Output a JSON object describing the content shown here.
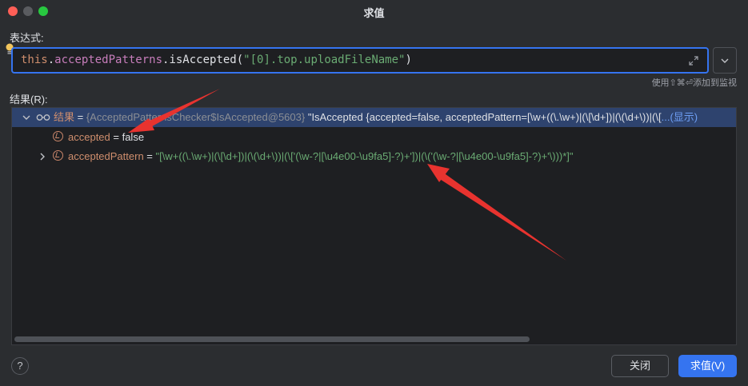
{
  "window": {
    "title": "求值"
  },
  "expression": {
    "label": "表达式:",
    "tokens": {
      "kw": "this",
      "dot1": ".",
      "field": "acceptedPatterns",
      "call": ".isAccepted(",
      "arg": "\"[0].top.uploadFileName\"",
      "close": ")"
    },
    "hint": "使用⇧⌘⏎添加到监视"
  },
  "result": {
    "label": "结果(R):",
    "root": {
      "name": "结果",
      "eq": " = ",
      "type": "{AcceptedPatternsChecker$IsAccepted@5603}",
      "value": " \"IsAccepted {accepted=false, acceptedPattern=[\\w+((\\.\\w+)|(\\[\\d+])|(\\(\\d+\\))|(\\[",
      "more": "...(显示)"
    },
    "children": [
      {
        "name": "accepted",
        "eq": " = ",
        "value": "false"
      },
      {
        "name": "acceptedPattern",
        "eq": " = ",
        "value": "\"[\\w+((\\.\\w+)|(\\[\\d+])|(\\(\\d+\\))|(\\['(\\w-?|[\\u4e00-\\u9fa5]-?)+'])|(\\('(\\w-?|[\\u4e00-\\u9fa5]-?)+'\\)))*]\""
      }
    ]
  },
  "buttons": {
    "help": "?",
    "close": "关闭",
    "evaluate": "求值(V)"
  },
  "colors": {
    "accent": "#3574f0",
    "keyword": "#cf8e6d",
    "string": "#6aab73",
    "annotation_arrow": "#e8332f"
  }
}
